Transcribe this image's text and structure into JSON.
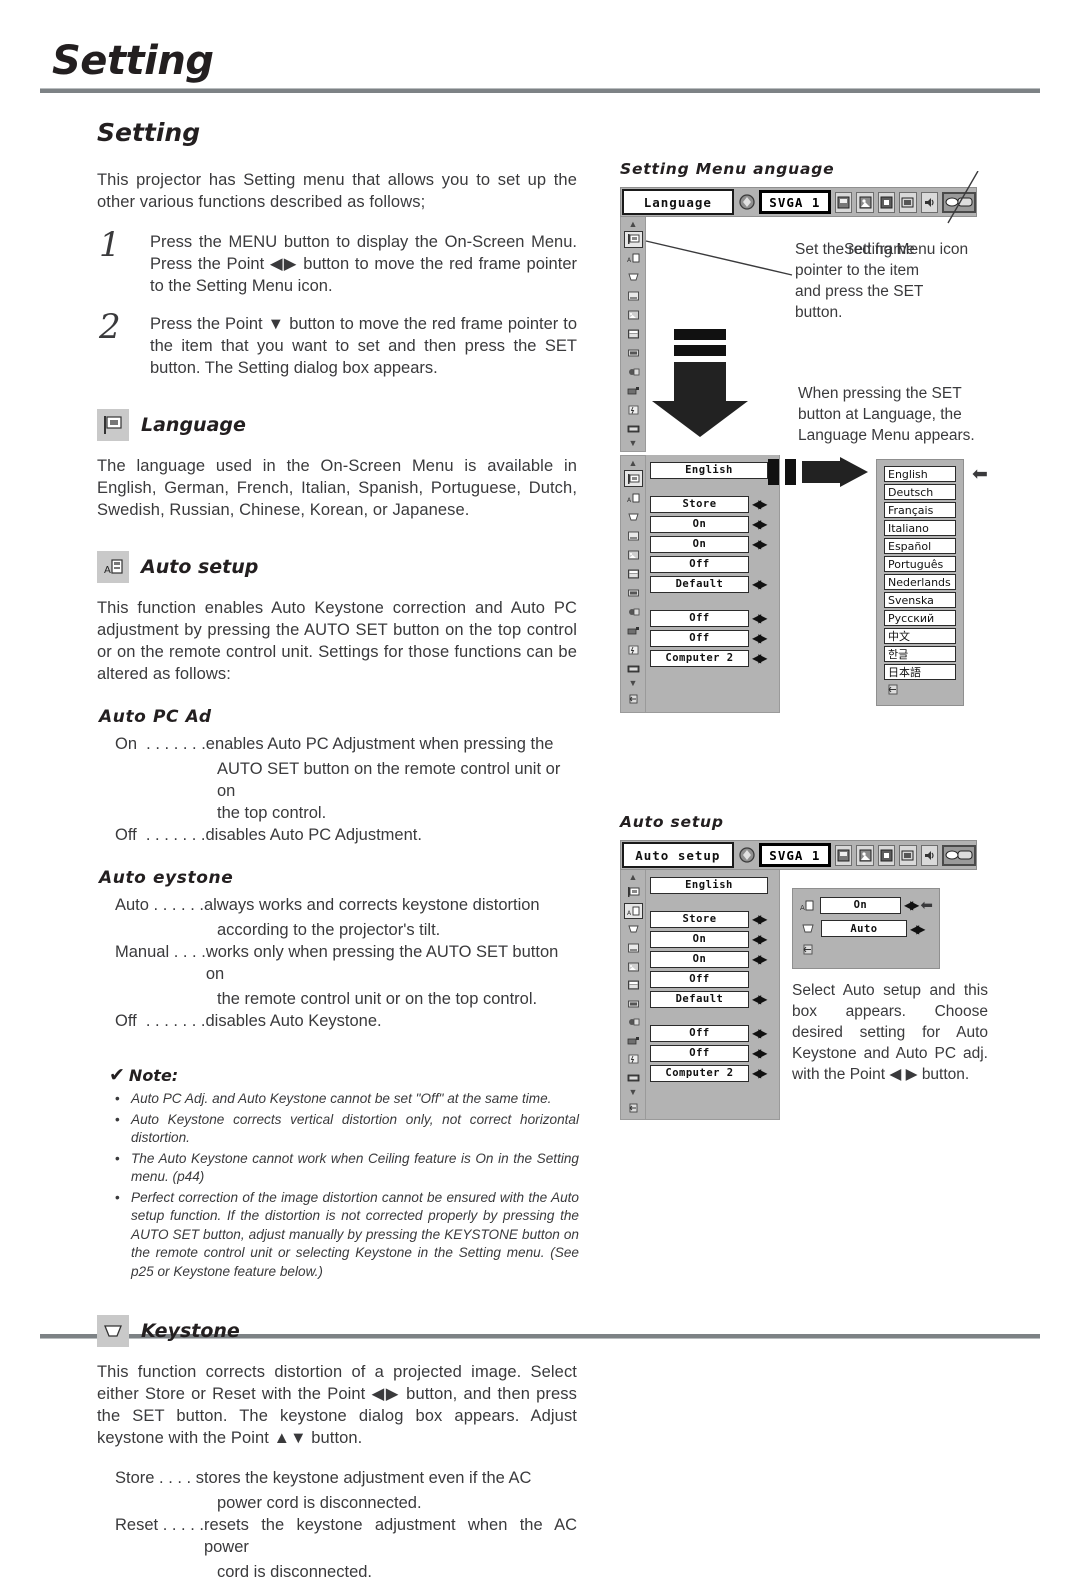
{
  "page": {
    "chapter_title": "Setting",
    "section_title": "Setting"
  },
  "intro": {
    "paragraph": "This projector has Setting menu that allows you to set up the other various functions described as follows;"
  },
  "steps": [
    {
      "num": "1",
      "text": "Press the MENU button to display the On-Screen Menu. Press the Point ◀▶ button to move the red frame pointer to the Setting Menu icon."
    },
    {
      "num": "2",
      "text": "Press the Point ▼ button to move the red frame pointer to the item that you want to set and then press the SET button. The Setting dialog box appears."
    }
  ],
  "features": {
    "language": {
      "icon": "language-flag-icon",
      "title": "Language",
      "body": "The language used in the On-Screen Menu is available in English, German, French, Italian, Spanish, Portuguese, Dutch, Swedish, Russian, Chinese, Korean, or Japanese."
    },
    "auto_setup": {
      "icon": "auto-setup-icon",
      "title": "Auto setup",
      "body": "This function enables Auto Keystone correction and Auto PC adjustment by pressing the AUTO SET button on the top control or on the remote control unit.  Settings for those functions can be altered as follows:",
      "auto_pc_adj": {
        "heading": "Auto PC Ad",
        "items": [
          {
            "term": "On",
            "dots": "  . . . . . . .",
            "desc": "enables Auto PC Adjustment when pressing the",
            "cont": [
              "AUTO SET button on the remote control unit or on",
              "the  top control."
            ]
          },
          {
            "term": "Off",
            "dots": "  . . . . . . .",
            "desc": "disables Auto PC Adjustment.",
            "cont": []
          }
        ]
      },
      "auto_keystone": {
        "heading": "Auto  eystone",
        "items": [
          {
            "term": "Auto",
            "dots": " . . . . . .",
            "desc": "always works and corrects keystone distortion",
            "cont": [
              "according to the projector's tilt."
            ]
          },
          {
            "term": "Manual",
            "dots": " . . . .",
            "desc": "works only when pressing the AUTO SET button on",
            "cont": [
              "the remote control unit or on the top control."
            ]
          },
          {
            "term": "Off",
            "dots": "  . . . . . . .",
            "desc": "disables Auto Keystone.",
            "cont": []
          }
        ]
      }
    },
    "keystone": {
      "icon": "keystone-trapezoid-icon",
      "title": "Keystone",
      "body": "This function corrects distortion of a projected image.  Select either Store or Reset with the Point ◀▶ button, and then press the SET button.  The keystone dialog box appears.  Adjust keystone with the Point ▲▼ button.",
      "items": [
        {
          "term": "Store",
          "dots": " . . . . ",
          "desc": "stores the keystone adjustment even if the AC",
          "cont": [
            "power cord is disconnected."
          ]
        },
        {
          "term": "Reset",
          "dots": " . . . . .",
          "desc": "resets the keystone adjustment when the AC power",
          "cont": [
            "cord is disconnected."
          ]
        }
      ]
    }
  },
  "note": {
    "check": "✔",
    "title": "Note:",
    "items": [
      "Auto PC Adj. and Auto Keystone cannot be set  \"Off\" at the same time.",
      "Auto Keystone corrects vertical distortion only, not correct horizontal distortion.",
      "The Auto Keystone cannot work when Ceiling feature is On in the Setting menu. (p44)",
      "Perfect correction of the image distortion cannot be ensured with the Auto setup function.  If the distortion is not corrected properly by pressing the AUTO SET button, adjust manually by pressing the KEYSTONE button on the remote control unit or selecting Keystone in the Setting menu.  (See p25 or Keystone feature below.)"
    ]
  },
  "osd": {
    "setting_menu_caption": "Setting Menu   anguage",
    "auto_setup_caption": "Auto setup",
    "topbar_language": {
      "title": "Language",
      "mode": "SVGA 1"
    },
    "topbar_autosetup": {
      "title": "Auto setup",
      "mode": "SVGA 1"
    },
    "rail_icons": [
      "language-flag-icon",
      "auto-setup-icon",
      "keystone-icon",
      "blue-back-icon",
      "display-icon",
      "logo-icon",
      "ceiling-icon",
      "rear-icon",
      "terminal-icon",
      "power-management-icon",
      "standby-icon"
    ],
    "menu_rows": [
      {
        "value": "English",
        "arrows": false
      },
      {
        "value": "",
        "arrows": false
      },
      {
        "value": "Store",
        "arrows": true
      },
      {
        "value": "On",
        "arrows": true
      },
      {
        "value": "On",
        "arrows": true
      },
      {
        "value": "Off",
        "arrows": false
      },
      {
        "value": "Default",
        "arrows": true
      },
      {
        "value": "",
        "arrows": false
      },
      {
        "value": "Off",
        "arrows": true
      },
      {
        "value": "Off",
        "arrows": true
      },
      {
        "value": "Computer 2",
        "arrows": true
      }
    ],
    "language_list": [
      "English",
      "Deutsch",
      "Français",
      "Italiano",
      "Español",
      "Português",
      "Nederlands",
      "Svenska",
      "Русский",
      "中文",
      "한글",
      "日本語"
    ],
    "auto_dialog": {
      "rows": [
        {
          "icon": "auto-pc-adj-icon",
          "value": "On"
        },
        {
          "icon": "auto-keystone-icon",
          "value": "Auto"
        }
      ]
    },
    "callouts": {
      "set_red_frame": "Set the red frame pointer to the item and press the SET button.",
      "setting_menu_icon": "Setting Menu icon",
      "when_pressing_set": "When pressing the SET button at Language, the Language Menu appears.",
      "select_auto_setup": "Select Auto setup and this box appears.  Choose desired setting for Auto Keystone and Auto PC adj. with the Point ◀ ▶ button."
    }
  }
}
